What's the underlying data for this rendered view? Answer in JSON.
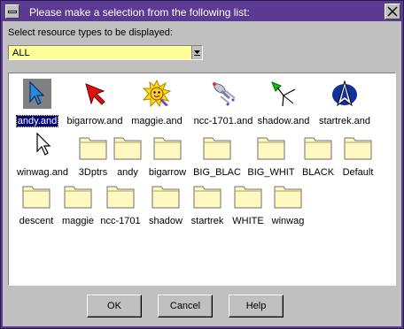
{
  "window": {
    "title": "Please make a selection from the following list:",
    "title_color": "#5a3a92"
  },
  "filter": {
    "label": "Select resource types to be displayed:",
    "value": "ALL",
    "background": "#ffff99"
  },
  "items": [
    {
      "label": "andy.and",
      "icon": "andy-cursor-icon",
      "selected": true
    },
    {
      "label": "bigarrow.and",
      "icon": "red-arrow-cursor-icon"
    },
    {
      "label": "maggie.and",
      "icon": "maggie-cursor-icon"
    },
    {
      "label": "ncc-1701.and",
      "icon": "starship-cursor-icon"
    },
    {
      "label": "shadow.and",
      "icon": "shadow-cursor-icon"
    },
    {
      "label": "startrek.and",
      "icon": "startrek-cursor-icon"
    },
    {
      "label": "winwag.and",
      "icon": "arrow-cursor-icon"
    },
    {
      "label": "3Dptrs",
      "icon": "folder-icon"
    },
    {
      "label": "andy",
      "icon": "folder-icon"
    },
    {
      "label": "bigarrow",
      "icon": "folder-icon"
    },
    {
      "label": "BIG_BLAC",
      "icon": "folder-icon"
    },
    {
      "label": "BIG_WHIT",
      "icon": "folder-icon"
    },
    {
      "label": "BLACK",
      "icon": "folder-icon"
    },
    {
      "label": "Default",
      "icon": "folder-icon"
    },
    {
      "label": "descent",
      "icon": "folder-icon"
    },
    {
      "label": "maggie",
      "icon": "folder-icon"
    },
    {
      "label": "ncc-1701",
      "icon": "folder-icon"
    },
    {
      "label": "shadow",
      "icon": "folder-icon"
    },
    {
      "label": "startrek",
      "icon": "folder-icon"
    },
    {
      "label": "WHITE",
      "icon": "folder-icon"
    },
    {
      "label": "winwag",
      "icon": "folder-icon"
    }
  ],
  "buttons": {
    "ok": "OK",
    "cancel": "Cancel",
    "help": "Help"
  }
}
